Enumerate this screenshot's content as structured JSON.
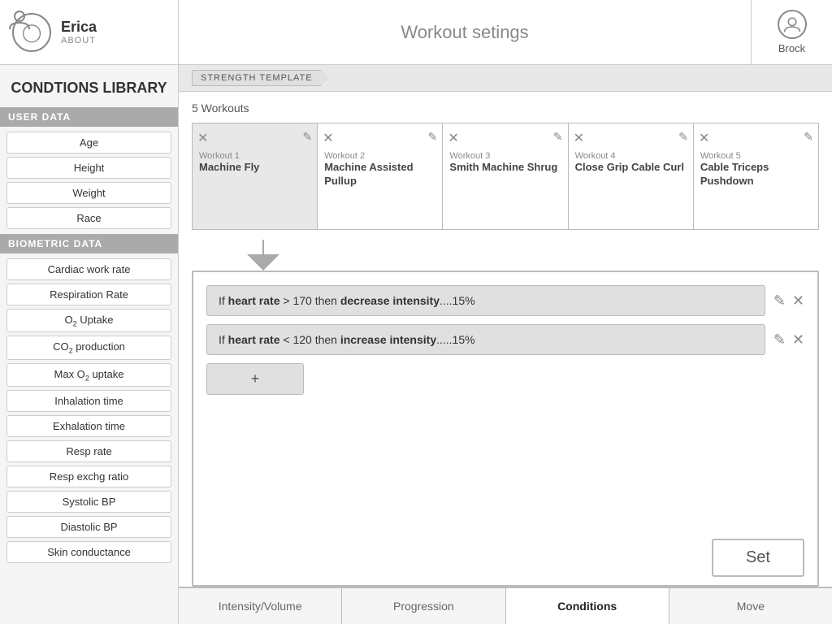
{
  "header": {
    "user_name": "Erica",
    "user_about": "ABOUT",
    "title": "Workout setings",
    "right_user": "Brock"
  },
  "breadcrumb": {
    "label": "STRENGTH TEMPLATE"
  },
  "workouts": {
    "count_label": "5 Workouts",
    "cards": [
      {
        "id": 1,
        "label": "Workout 1",
        "name": "Machine Fly",
        "selected": true
      },
      {
        "id": 2,
        "label": "Workout 2",
        "name": "Machine Assisted Pullup",
        "selected": false
      },
      {
        "id": 3,
        "label": "Workout 3",
        "name": "Smith Machine Shrug",
        "selected": false
      },
      {
        "id": 4,
        "label": "Workout 4",
        "name": "Close Grip Cable Curl",
        "selected": false
      },
      {
        "id": 5,
        "label": "Workout 5",
        "name": "Cable Triceps Pushdown",
        "selected": false
      }
    ]
  },
  "conditions": {
    "rule1": "If heart rate > 170 then decrease intensity....15%",
    "rule1_prefix": "If ",
    "rule1_keyword1": "heart rate",
    "rule1_op": " > 170 then ",
    "rule1_keyword2": "decrease intensity",
    "rule1_suffix": "....15%",
    "rule2_prefix": "If ",
    "rule2_keyword1": "heart rate",
    "rule2_op": " < 120 then ",
    "rule2_keyword2": "increase intensity",
    "rule2_suffix": ".....15%",
    "add_btn": "+",
    "set_btn": "Set"
  },
  "tabs": [
    {
      "label": "Intensity/Volume",
      "active": false
    },
    {
      "label": "Progression",
      "active": false
    },
    {
      "label": "Conditions",
      "active": true
    },
    {
      "label": "Move",
      "active": false
    }
  ],
  "sidebar": {
    "title": "CONDTIONS LIBRARY",
    "sections": [
      {
        "header": "USER DATA",
        "items": [
          "Age",
          "Height",
          "Weight",
          "Race"
        ]
      },
      {
        "header": "BIOMETRIC DATA",
        "items": [
          "Cardiac work rate",
          "Respiration Rate",
          "O₂ Uptake",
          "CO₂ production",
          "Max O₂ uptake",
          "Inhalation time",
          "Exhalation time",
          "Resp rate",
          "Resp exchg ratio",
          "Systolic BP",
          "Diastolic BP",
          "Skin conductance"
        ]
      }
    ]
  }
}
